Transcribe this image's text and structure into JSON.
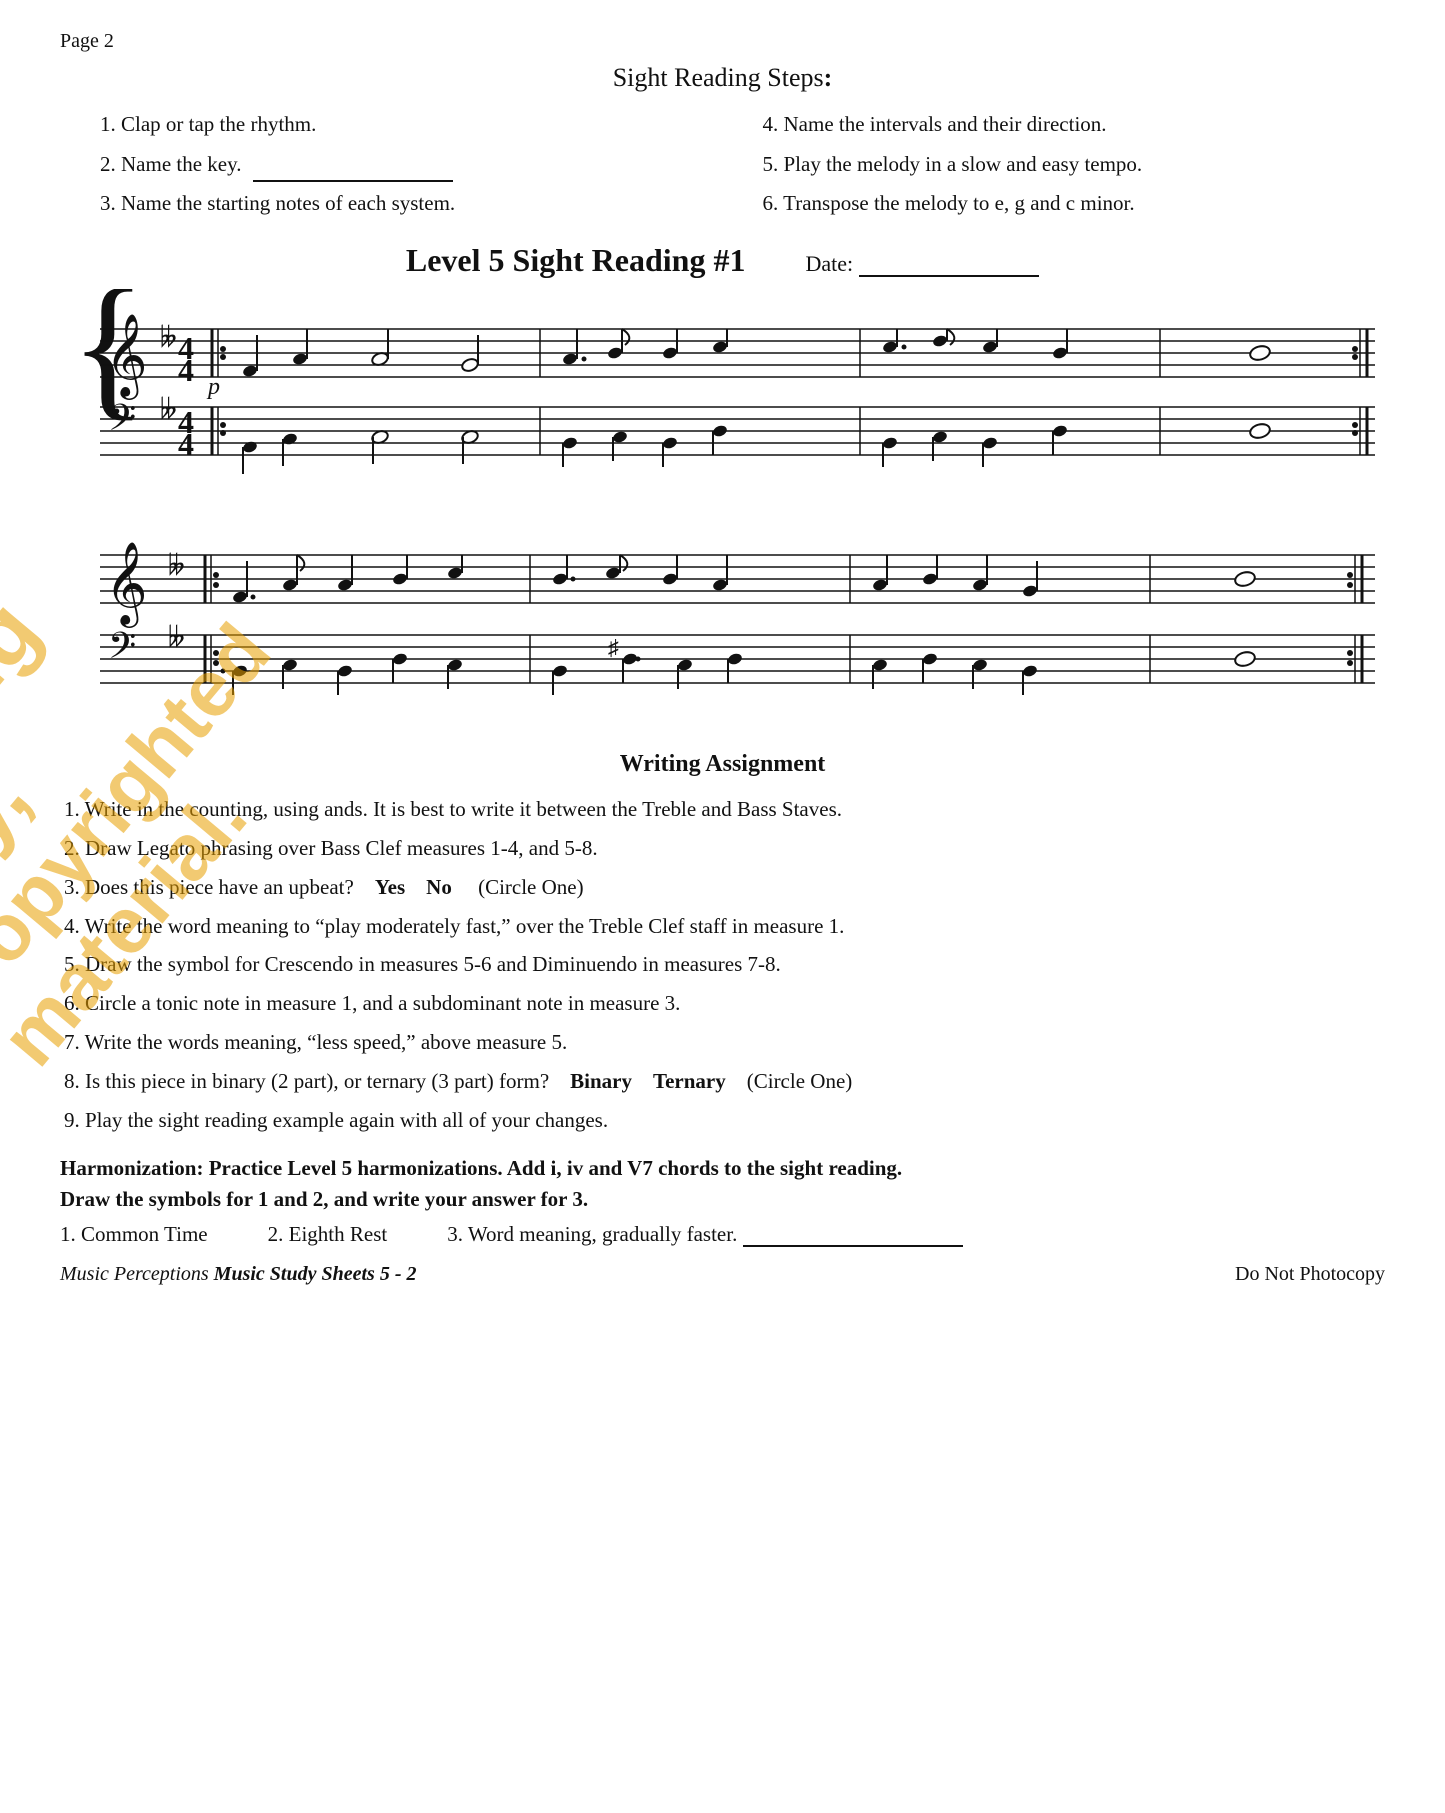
{
  "page": {
    "page_number": "Page 2",
    "title": "Sight Reading Steps:",
    "steps": [
      {
        "number": "1.",
        "text": "Clap or tap the rhythm."
      },
      {
        "number": "4.",
        "text": "Name the intervals and their direction."
      },
      {
        "number": "2.",
        "text": "Name the key."
      },
      {
        "number": "5.",
        "text": "Play the melody in a slow and easy tempo."
      },
      {
        "number": "3.",
        "text": "Name the starting notes of each system."
      },
      {
        "number": "6.",
        "text": "Transpose the melody to e, g and c minor."
      }
    ],
    "level_title": "Level 5 Sight Reading #1",
    "date_label": "Date:",
    "writing_assignment": {
      "title": "Writing Assignment",
      "items": [
        "1. Write in the counting, using ands. It is best to write it between the Treble and Bass Staves.",
        "2. Draw Legato phrasing over Bass Clef measures 1-4, and 5-8.",
        "3. Does this piece have an upbeat?    Yes    No    (Circle One)",
        "4. Write the word meaning to “play moderately fast,” over the Treble Clef staff in measure 1.",
        "5. Draw the symbol for Crescendo in measures 5-6 and Diminuendo in measures 7-8.",
        "6. Circle a tonic note in measure 1, and a subdominant note in measure 3.",
        "7. Write the words meaning, “less speed,” above measure 5.",
        "8. Is this piece in binary (2 part), or ternary (3 part) form?    Binary    Ternary    (Circle One)",
        "9. Play the sight reading example again with all of your changes."
      ]
    },
    "harmonization": {
      "title": "Harmonization: Practice Level 5 harmonizations.",
      "title_suffix": " Add i, iv and V7 chords to the sight reading.",
      "subtitle": "Draw the symbols for 1 and 2, and write your answer for 3.",
      "symbols": [
        {
          "number": "1.",
          "label": "Common Time"
        },
        {
          "number": "2.",
          "label": "Eighth Rest"
        },
        {
          "number": "3.",
          "label": "Word meaning, gradually faster."
        }
      ]
    },
    "footer": {
      "left_italic": "Music Perceptions ",
      "left_bold": "Music Study Sheets 5 - 2",
      "right": "Do Not Photocopy"
    }
  }
}
